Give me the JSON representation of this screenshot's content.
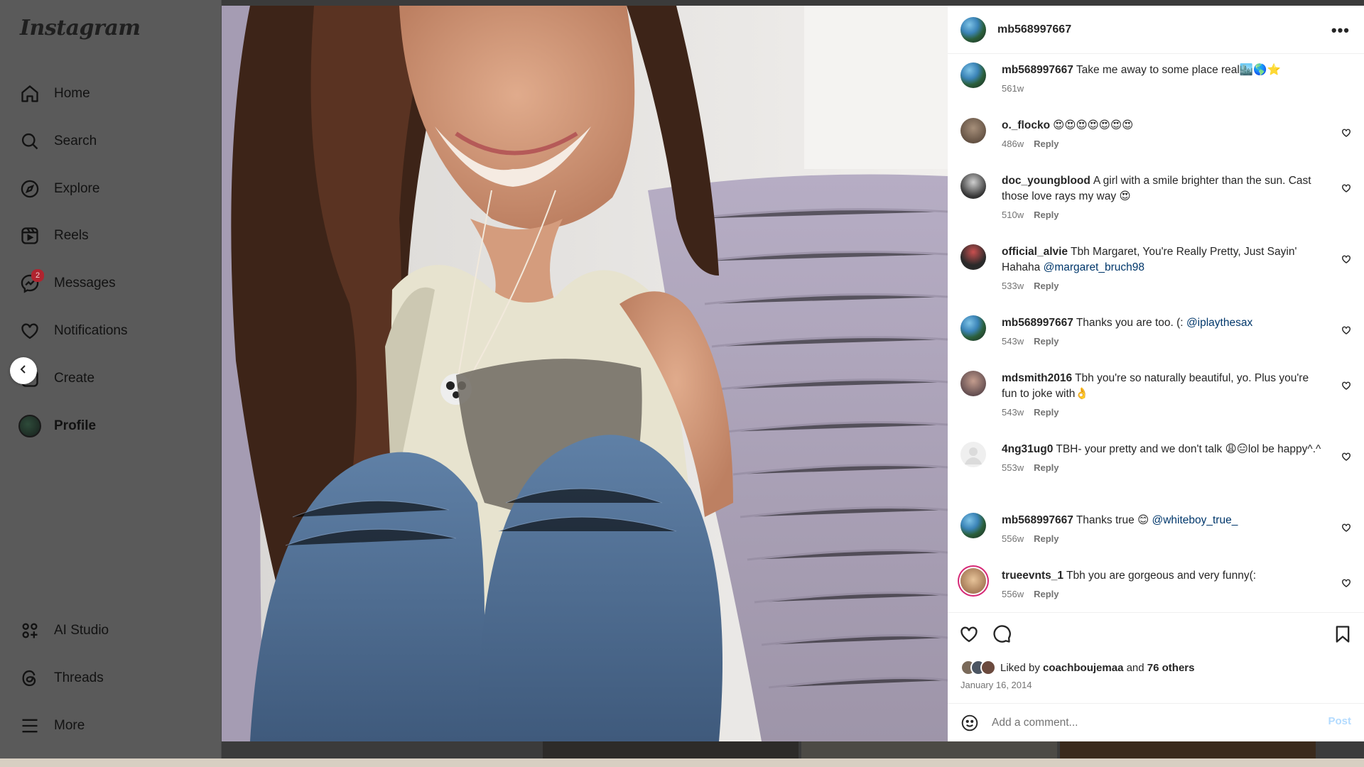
{
  "app": {
    "logo": "Instagram"
  },
  "sidebar": {
    "items": [
      {
        "label": "Home",
        "icon": "home-icon"
      },
      {
        "label": "Search",
        "icon": "search-icon"
      },
      {
        "label": "Explore",
        "icon": "compass-icon"
      },
      {
        "label": "Reels",
        "icon": "reels-icon"
      },
      {
        "label": "Messages",
        "icon": "messenger-icon",
        "badge": "2"
      },
      {
        "label": "Notifications",
        "icon": "heart-icon"
      },
      {
        "label": "Create",
        "icon": "plus-square-icon"
      },
      {
        "label": "Profile",
        "icon": "avatar"
      },
      {
        "label": "AI Studio",
        "icon": "ai-studio-icon"
      },
      {
        "label": "Threads",
        "icon": "threads-icon"
      },
      {
        "label": "More",
        "icon": "menu-icon"
      }
    ]
  },
  "post": {
    "author": "mb568997667",
    "caption": {
      "user": "mb568997667",
      "text": "Take me away to some place real🏙️🌎⭐",
      "time": "561w"
    },
    "comments": [
      {
        "user": "o._flocko",
        "text": "😍😍😍😍😍😍😍",
        "time": "486w",
        "reply": "Reply"
      },
      {
        "user": "doc_youngblood",
        "text": "A girl with a smile brighter than the sun. Cast those love rays my way 😍",
        "time": "510w",
        "reply": "Reply"
      },
      {
        "user": "official_alvie",
        "text": "Tbh Margaret, You're Really Pretty, Just Sayin' Hahaha",
        "mention": "@margaret_bruch98",
        "time": "533w",
        "reply": "Reply"
      },
      {
        "user": "mb568997667",
        "text": "Thanks you are too. (:",
        "mention": "@iplaythesax",
        "time": "543w",
        "reply": "Reply"
      },
      {
        "user": "mdsmith2016",
        "text": "Tbh you're so naturally beautiful, yo. Plus you're fun to joke with👌",
        "time": "543w",
        "reply": "Reply"
      },
      {
        "user": "4ng31ug0",
        "text": "TBH- your pretty and we don't talk 😩😑lol be happy^.^",
        "time": "553w",
        "reply": "Reply"
      },
      {
        "user": "mb568997667",
        "text": "Thanks true 😊",
        "mention": "@whiteboy_true_",
        "time": "556w",
        "reply": "Reply"
      },
      {
        "user": "trueevnts_1",
        "text": "Tbh you are gorgeous and very funny(:",
        "time": "556w",
        "reply": "Reply"
      }
    ],
    "likes": {
      "prefix": "Liked by",
      "user": "coachboujemaa",
      "and": "and",
      "others": "76 others"
    },
    "date": "January 16, 2014",
    "add_comment": {
      "placeholder": "Add a comment...",
      "post_label": "Post"
    }
  }
}
